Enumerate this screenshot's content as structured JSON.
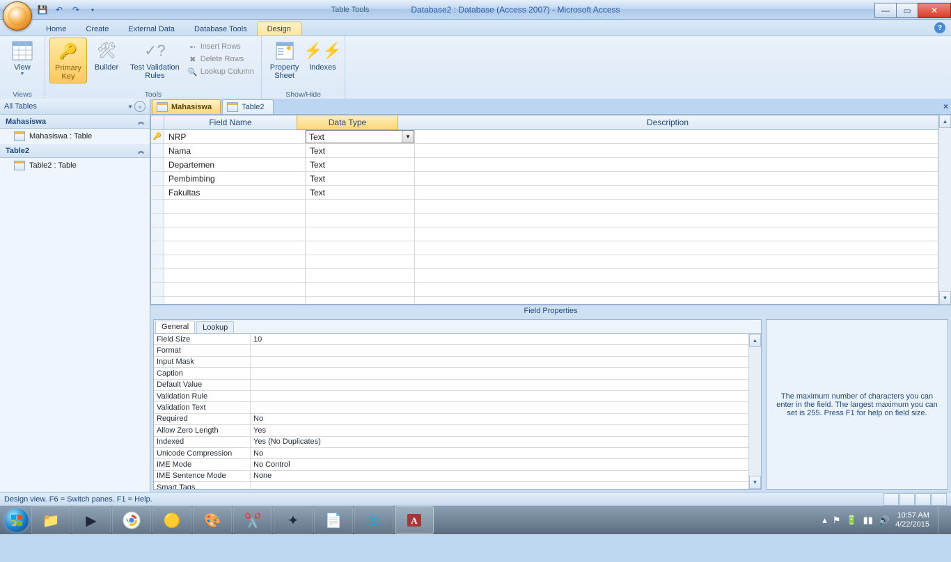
{
  "titlebar": {
    "context_label": "Table Tools",
    "app_title": "Database2 : Database (Access 2007) - Microsoft Access"
  },
  "ribbon_tabs": {
    "home": "Home",
    "create": "Create",
    "external": "External Data",
    "dbtools": "Database Tools",
    "design": "Design"
  },
  "ribbon": {
    "views": {
      "view": "View",
      "group": "Views"
    },
    "tools": {
      "primary_key": "Primary\nKey",
      "builder": "Builder",
      "test_validation": "Test Validation\nRules",
      "insert_rows": "Insert Rows",
      "delete_rows": "Delete Rows",
      "lookup_column": "Lookup Column",
      "group": "Tools"
    },
    "showhide": {
      "property_sheet": "Property\nSheet",
      "indexes": "Indexes",
      "group": "Show/Hide"
    }
  },
  "nav": {
    "header": "All Tables",
    "groups": [
      {
        "title": "Mahasiswa",
        "item": "Mahasiswa : Table"
      },
      {
        "title": "Table2",
        "item": "Table2 : Table"
      }
    ]
  },
  "tabs": {
    "t1": "Mahasiswa",
    "t2": "Table2"
  },
  "grid": {
    "headers": {
      "field_name": "Field Name",
      "data_type": "Data Type",
      "description": "Description"
    },
    "rows": [
      {
        "pk": true,
        "name": "NRP",
        "type": "Text",
        "selected": true
      },
      {
        "pk": false,
        "name": "Nama",
        "type": "Text"
      },
      {
        "pk": false,
        "name": "Departemen",
        "type": "Text"
      },
      {
        "pk": false,
        "name": "Pembimbing",
        "type": "Text"
      },
      {
        "pk": false,
        "name": "Fakultas",
        "type": "Text"
      }
    ]
  },
  "fp": {
    "title": "Field Properties",
    "tab_general": "General",
    "tab_lookup": "Lookup",
    "rows": [
      {
        "k": "Field Size",
        "v": "10"
      },
      {
        "k": "Format",
        "v": ""
      },
      {
        "k": "Input Mask",
        "v": ""
      },
      {
        "k": "Caption",
        "v": ""
      },
      {
        "k": "Default Value",
        "v": ""
      },
      {
        "k": "Validation Rule",
        "v": ""
      },
      {
        "k": "Validation Text",
        "v": ""
      },
      {
        "k": "Required",
        "v": "No"
      },
      {
        "k": "Allow Zero Length",
        "v": "Yes"
      },
      {
        "k": "Indexed",
        "v": "Yes (No Duplicates)"
      },
      {
        "k": "Unicode Compression",
        "v": "No"
      },
      {
        "k": "IME Mode",
        "v": "No Control"
      },
      {
        "k": "IME Sentence Mode",
        "v": "None"
      },
      {
        "k": "Smart Tags",
        "v": ""
      }
    ],
    "help": "The maximum number of characters you can enter in the field.  The largest maximum you can set is 255.  Press F1 for help on field size."
  },
  "status": {
    "text": "Design view.   F6 = Switch panes.   F1 = Help."
  },
  "tray": {
    "time": "10:57 AM",
    "date": "4/22/2015"
  }
}
